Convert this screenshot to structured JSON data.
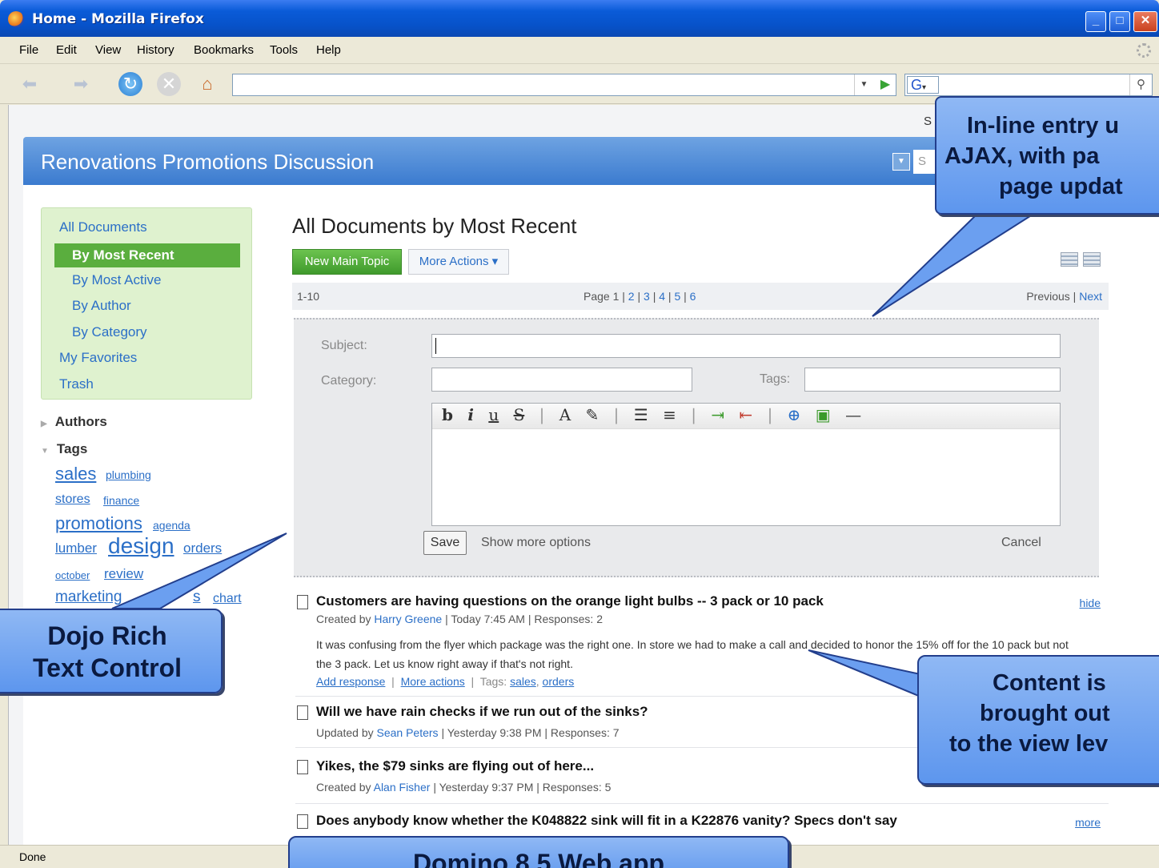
{
  "window": {
    "title": "Home - Mozilla Firefox",
    "min": "_",
    "max": "□",
    "close": "✕"
  },
  "menubar": [
    "File",
    "Edit",
    "View",
    "History",
    "Bookmarks",
    "Tools",
    "Help"
  ],
  "navbar": {
    "url": "",
    "search_engine": "G",
    "search_value": ""
  },
  "page": {
    "top_link_partial": "S",
    "banner_title": "Renovations Promotions Discussion",
    "banner_search_placeholder": "S",
    "sidebar": {
      "all_documents": "All Documents",
      "selected": "By Most Recent",
      "items": [
        "By Most Active",
        "By Author",
        "By Category"
      ],
      "favorites": "My Favorites",
      "trash": "Trash",
      "authors": "Authors",
      "tags_heading": "Tags",
      "tags": [
        "sales",
        "plumbing",
        "stores",
        "finance",
        "promotions",
        "agenda",
        "lumber",
        "design",
        "orders",
        "october",
        "review",
        "marketing",
        "s",
        "chart"
      ]
    },
    "heading": "All Documents by Most Recent",
    "new_topic": "New Main Topic",
    "more_actions": "More Actions ▾",
    "pager": {
      "range": "1-10",
      "page_label": "Page 1 |",
      "pages": [
        "2",
        "3",
        "4",
        "5",
        "6"
      ],
      "previous": "Previous |",
      "next": "Next"
    },
    "form": {
      "subject_label": "Subject:",
      "subject_value": "",
      "category_label": "Category:",
      "category_value": "",
      "tags_label": "Tags:",
      "tags_value": "",
      "toolbar": [
        "b",
        "i",
        "u",
        "S",
        "|",
        "A",
        "✎",
        "|",
        "☰",
        "≡",
        "|",
        "⇥",
        "⇤",
        "|",
        "⊕",
        "▣",
        "—"
      ],
      "save": "Save",
      "show_more": "Show more options",
      "cancel": "Cancel"
    },
    "documents": [
      {
        "title": "Customers are having questions on the orange light bulbs -- 3 pack or 10 pack",
        "meta_prefix": "Created by",
        "author": "Harry Greene",
        "meta_suffix": "| Today 7:45 AM | Responses: 2",
        "side": "hide",
        "body": "It was confusing from the flyer which package was the right one. In store we had to make a call and decided to honor the 15% off for the 10 pack but not the 3 pack. Let us know right away if that's not right.",
        "add_response": "Add response",
        "more_actions": "More actions",
        "tags_label": "Tags:",
        "tag1": "sales",
        "tag2": "orders"
      },
      {
        "title": "Will we have rain checks if we run out of the sinks?",
        "meta_prefix": "Updated by",
        "author": "Sean Peters",
        "meta_suffix": "| Yesterday 9:38 PM | Responses: 7"
      },
      {
        "title": "Yikes, the $79 sinks are flying out of here...",
        "meta_prefix": "Created by",
        "author": "Alan Fisher",
        "meta_suffix": "| Yesterday 9:37 PM | Responses: 5"
      },
      {
        "title": "Does anybody know whether the K048822 sink will fit in a K22876 vanity? Specs don't say",
        "side": "more"
      }
    ]
  },
  "status": "Done",
  "callouts": {
    "top_right": [
      "In-line entry u",
      "AJAX, with pa",
      "page updat"
    ],
    "left": [
      "Dojo Rich",
      "Text Control"
    ],
    "right": [
      "Content is",
      "brought out",
      "to the view  lev"
    ],
    "bottom": "Domino 8.5 Web app"
  }
}
